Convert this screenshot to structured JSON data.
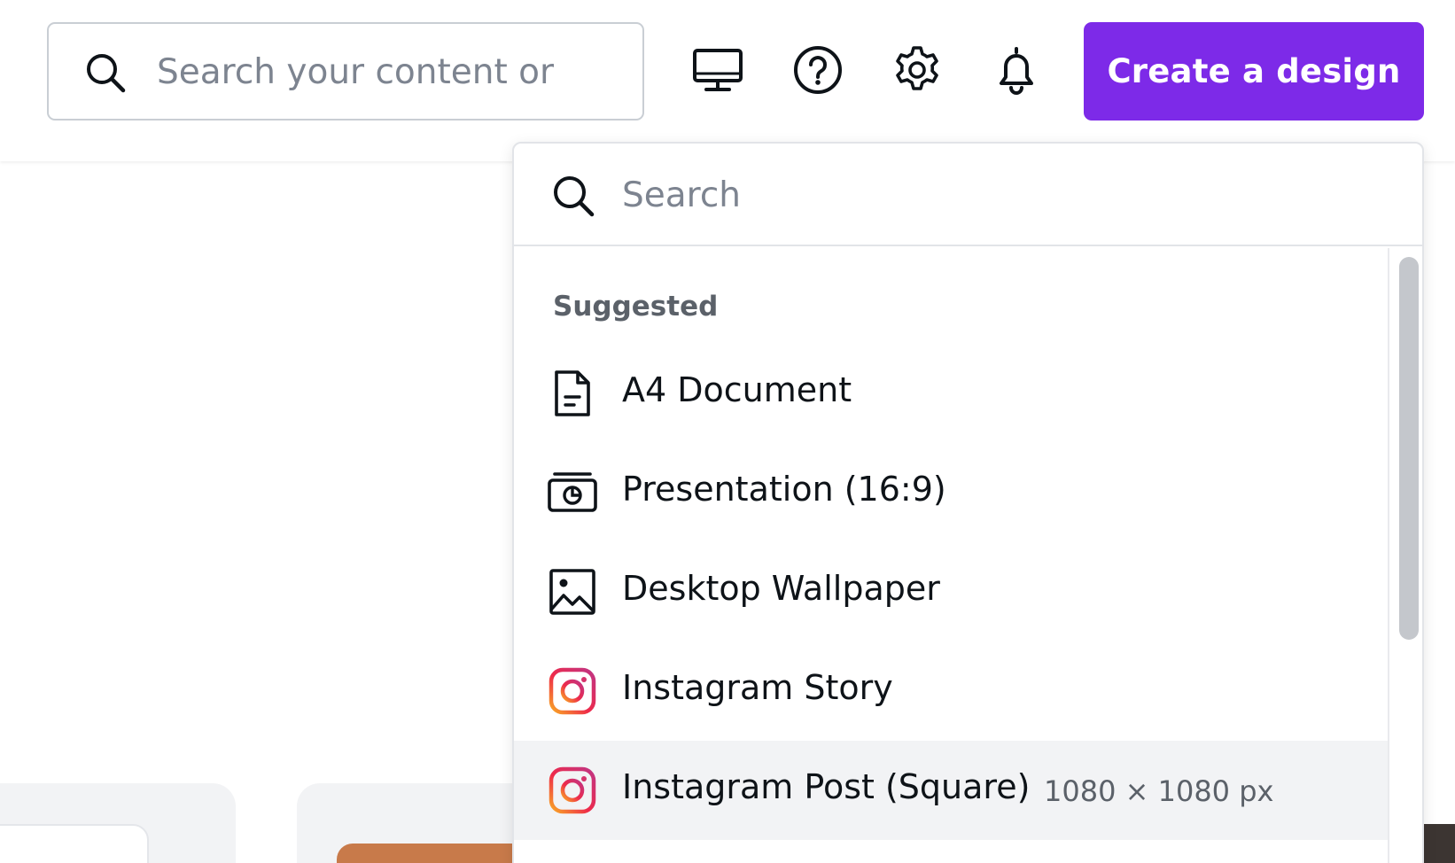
{
  "header": {
    "search_placeholder": "Search your content or",
    "icons": [
      "desktop-icon",
      "help-icon",
      "gear-icon",
      "bell-icon"
    ],
    "create_button_label": "Create a design"
  },
  "dropdown": {
    "search_placeholder": "Search",
    "section_label": "Suggested",
    "items": [
      {
        "label": "A4 Document",
        "icon": "document-icon",
        "meta": ""
      },
      {
        "label": "Presentation (16:9)",
        "icon": "presentation-icon",
        "meta": ""
      },
      {
        "label": "Desktop Wallpaper",
        "icon": "image-icon",
        "meta": ""
      },
      {
        "label": "Instagram Story",
        "icon": "instagram-icon",
        "meta": ""
      },
      {
        "label": "Instagram Post (Square)",
        "icon": "instagram-icon",
        "meta": "1080 × 1080 px"
      }
    ]
  },
  "colors": {
    "accent": "#7d2ae8",
    "text": "#0e1318",
    "muted": "#5b6169",
    "hover_row": "#f2f3f5"
  }
}
